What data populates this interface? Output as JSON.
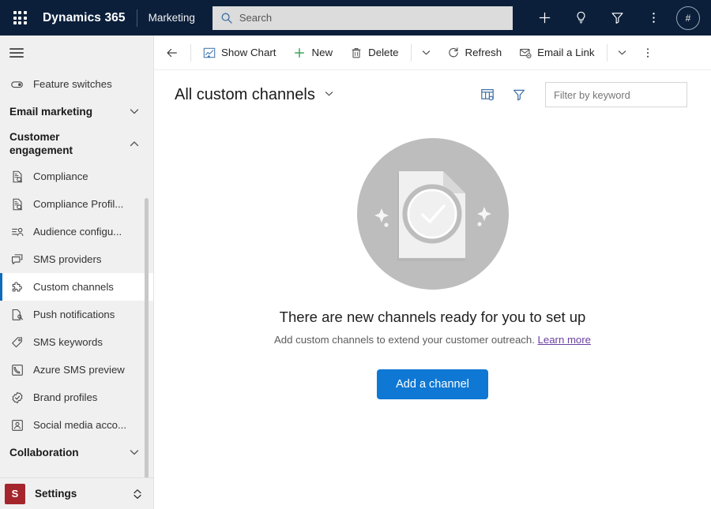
{
  "header": {
    "waffle_icon": "waffle-grid-icon",
    "brand": "Dynamics 365",
    "app_name": "Marketing",
    "search": {
      "placeholder": "Search",
      "value": "",
      "icon": "search-icon"
    },
    "actions": [
      {
        "name": "quick-create-button",
        "icon": "plus-icon"
      },
      {
        "name": "help-button",
        "icon": "lightbulb-icon"
      },
      {
        "name": "filter-button",
        "icon": "funnel-icon"
      },
      {
        "name": "more-options-button",
        "icon": "ellipsis-vertical-icon"
      }
    ],
    "avatar_label": "#"
  },
  "command_bar": {
    "back_icon": "arrow-left-icon",
    "buttons": [
      {
        "label": "Show Chart",
        "icon": "chart-icon"
      },
      {
        "label": "New",
        "icon": "plus-icon"
      },
      {
        "label": "Delete",
        "icon": "trash-icon"
      }
    ],
    "delete_caret_icon": "chevron-down-icon",
    "right_buttons": [
      {
        "label": "Refresh",
        "icon": "refresh-icon"
      },
      {
        "label": "Email a Link",
        "icon": "email-link-icon"
      }
    ],
    "right_caret_icon": "chevron-down-icon",
    "overflow_icon": "ellipsis-vertical-icon"
  },
  "view": {
    "title": "All custom channels",
    "title_chevron_icon": "chevron-down-icon",
    "edit_columns_icon": "edit-columns-icon",
    "edit_filters_icon": "funnel-icon",
    "filter_input": {
      "placeholder": "Filter by keyword",
      "value": ""
    }
  },
  "sidebar": {
    "hamburger_icon": "hamburger-icon",
    "items": [
      {
        "label": "Feature switches",
        "icon": "toggle-icon",
        "type": "item",
        "selected": false
      },
      {
        "label": "Email marketing",
        "icon": "chevron-down-icon",
        "type": "group",
        "expanded": false
      },
      {
        "label": "Customer engagement",
        "icon": "chevron-up-icon",
        "type": "group",
        "expanded": true
      },
      {
        "label": "Compliance",
        "icon": "document-search-icon",
        "type": "item",
        "selected": false
      },
      {
        "label": "Compliance Profil...",
        "icon": "document-search-icon",
        "type": "item",
        "selected": false
      },
      {
        "label": "Audience configu...",
        "icon": "audience-icon",
        "type": "item",
        "selected": false
      },
      {
        "label": "SMS providers",
        "icon": "chat-bubble-icon",
        "type": "item",
        "selected": false
      },
      {
        "label": "Custom channels",
        "icon": "puzzle-piece-icon",
        "type": "item",
        "selected": true
      },
      {
        "label": "Push notifications",
        "icon": "page-pen-icon",
        "type": "item",
        "selected": false
      },
      {
        "label": "SMS keywords",
        "icon": "tag-icon",
        "type": "item",
        "selected": false
      },
      {
        "label": "Azure SMS preview",
        "icon": "azure-sms-icon",
        "type": "item",
        "selected": false
      },
      {
        "label": "Brand profiles",
        "icon": "badge-check-icon",
        "type": "item",
        "selected": false
      },
      {
        "label": "Social media acco...",
        "icon": "social-account-icon",
        "type": "item",
        "selected": false
      },
      {
        "label": "Collaboration",
        "icon": "chevron-down-icon",
        "type": "group",
        "expanded": false
      }
    ],
    "footer": {
      "badge": "S",
      "label": "Settings",
      "chevron_icon": "chevron-up-down-icon"
    }
  },
  "empty_state": {
    "illustration": "document-check-circle-illustration",
    "heading": "There are new channels ready for you to set up",
    "subtext": "Add custom channels to extend your customer outreach.",
    "link": "Learn more",
    "cta_label": "Add a channel"
  },
  "colors": {
    "header_bg": "#0b1f3b",
    "accent_blue": "#0f78d4",
    "selected_border": "#0f6cbd",
    "link_purple": "#6b3fa0",
    "settings_badge": "#a4262c",
    "sidebar_bg": "#f0f0f0",
    "new_green": "#3ba55d"
  }
}
